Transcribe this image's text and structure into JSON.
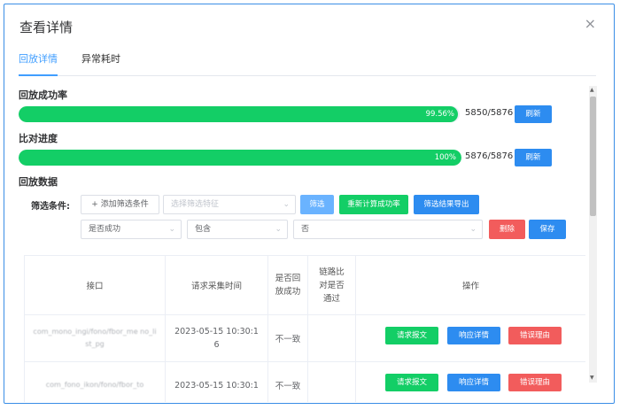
{
  "dialog": {
    "title": "查看详情",
    "close_icon": "×"
  },
  "tabs": [
    {
      "label": "回放详情",
      "active": true
    },
    {
      "label": "异常耗时",
      "active": false
    }
  ],
  "replay_success": {
    "label": "回放成功率",
    "percent_text": "99.56%",
    "percent_value": 99.56,
    "count": "5850/5876",
    "refresh_label": "刷新"
  },
  "compare_progress": {
    "label": "比对进度",
    "percent_text": "100%",
    "percent_value": 100,
    "count": "5876/5876",
    "refresh_label": "刷新"
  },
  "replay_data": {
    "label": "回放数据",
    "filter_label": "筛选条件:",
    "add_filter_label": "+ 添加筛选条件",
    "feature_placeholder": "选择筛选特征",
    "filter_button": "筛选",
    "recalc_button": "重新计算成功率",
    "export_button": "筛选结果导出",
    "condition": {
      "field": "是否成功",
      "operator": "包含",
      "value": "否"
    },
    "delete_button": "删除",
    "save_button": "保存"
  },
  "table": {
    "headers": [
      "接口",
      "请求采集时间",
      "是否回放成功",
      "链路比对是否通过",
      "操作"
    ],
    "rows": [
      {
        "api": "com_mono_ingi/fono/fbor_me no_list_pg",
        "time": "2023-05-15 10:30:16",
        "success": "不一致",
        "link": ""
      },
      {
        "api": "com_fono_ikon/fono/fbor_to",
        "time": "2023-05-15 10:30:1",
        "success": "不一致",
        "link": ""
      }
    ],
    "actions": {
      "request": "请求报文",
      "response": "响应详情",
      "error": "错误理由"
    }
  },
  "colors": {
    "accent": "#409eff",
    "success": "#13ce66",
    "danger": "#f25c5c",
    "primary_btn": "#2d8cf0"
  }
}
